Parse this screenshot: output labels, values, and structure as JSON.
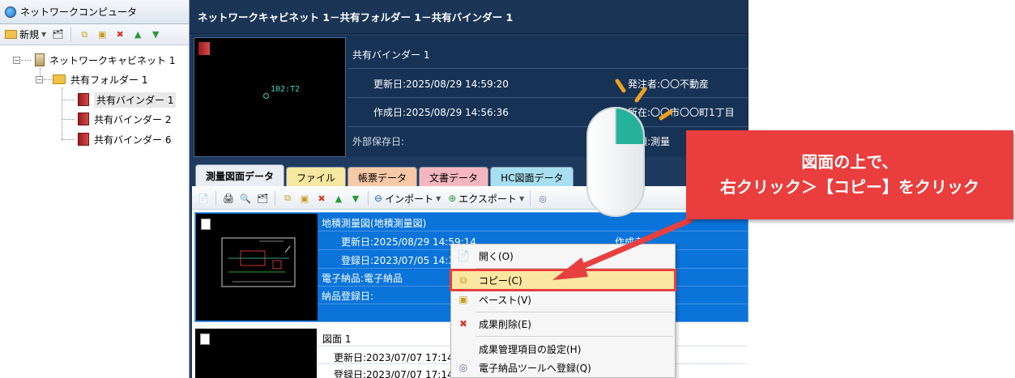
{
  "left_pane": {
    "title": "ネットワークコンピュータ",
    "toolbar": {
      "new_label": "新規"
    },
    "tree": {
      "cabinet": "ネットワークキャビネット 1",
      "folder": "共有フォルダー 1",
      "binders": [
        "共有バインダー 1",
        "共有バインダー 2",
        "共有バインダー 6"
      ]
    }
  },
  "right_pane": {
    "path": "ネットワークキャビネット 1－共有フォルダー 1－共有バインダー 1",
    "info": {
      "name": "共有バインダー 1",
      "thumb_label": "102:T2",
      "updated": "更新日:2025/08/29 14:59:20",
      "created": "作成日:2025/08/29 14:56:36",
      "external": "外部保存日:",
      "orderer": "発注者:〇〇不動産",
      "location": "所在:〇〇市〇〇町1丁目",
      "category": "分類:測量"
    },
    "tabs": [
      {
        "label": "測量図面データ",
        "color": "#e9eef4"
      },
      {
        "label": "ファイル",
        "color": "#f7e7a0"
      },
      {
        "label": "帳票データ",
        "color": "#f7c9a6"
      },
      {
        "label": "文書データ",
        "color": "#f4b7c0"
      },
      {
        "label": "HC図面データ",
        "color": "#a8dff0"
      }
    ],
    "toolbar": {
      "import_label": "インポート",
      "export_label": "エクスポート"
    },
    "records": [
      {
        "title": "地積測量図(地積測量図)",
        "updated": "更新日:2025/08/29 14:59:14",
        "registered": "登録日:2023/07/05 14:37",
        "creator": "作成者:",
        "einput": "電子納品:電子納品",
        "delivery": "納品登録日:"
      },
      {
        "title": "図面 1",
        "updated": "更新日:2023/07/07 17:14:56",
        "registered": "登録日:2023/07/07 17:14:55"
      }
    ]
  },
  "context_menu": {
    "items": [
      {
        "label": "開く(O)",
        "icon": "open-icon"
      },
      {
        "label": "コピー(C)",
        "icon": "copy-icon"
      },
      {
        "label": "ペースト(V)",
        "icon": "paste-icon"
      },
      {
        "label": "成果削除(E)",
        "icon": "delete-icon"
      },
      {
        "label": "成果管理項目の設定(H)",
        "icon": "settings-icon"
      },
      {
        "label": "電子納品ツールへ登録(Q)",
        "icon": "register-icon"
      }
    ]
  },
  "callout": {
    "line1": "図面の上で、",
    "line2": "右クリック＞【コピー】をクリック"
  },
  "colors": {
    "callout": "#ea3d3d",
    "selected_row": "#0a74da",
    "mouse_accent": "#24b39a",
    "click_marks": "#f0a020"
  }
}
